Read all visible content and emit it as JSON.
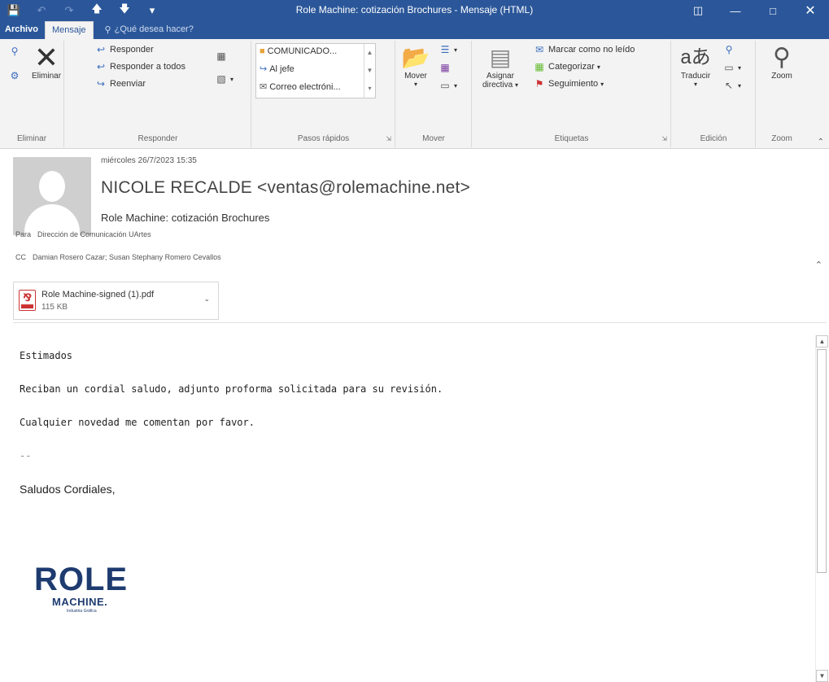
{
  "window": {
    "title": "Role Machine: cotización Brochures - Mensaje (HTML)",
    "accent": "#2b579a",
    "qat": [
      "save-icon",
      "undo-icon",
      "redo-icon",
      "arrow-up-icon",
      "arrow-down-icon",
      "customize-icon"
    ]
  },
  "tabs": {
    "file": "Archivo",
    "message": "Mensaje",
    "tell_me": "¿Qué desea hacer?"
  },
  "ribbon": {
    "delete": {
      "label": "Eliminar",
      "button": "Eliminar"
    },
    "respond": {
      "label": "Responder",
      "reply": "Responder",
      "reply_all": "Responder a todos",
      "forward": "Reenviar"
    },
    "quick_steps": {
      "label": "Pasos rápidos",
      "items": [
        "COMUNICADO...",
        "Al jefe",
        "Correo electróni..."
      ]
    },
    "move": {
      "label": "Mover",
      "button": "Mover"
    },
    "tags": {
      "label": "Etiquetas",
      "assign_policy_1": "Asignar",
      "assign_policy_2": "directiva",
      "mark_unread": "Marcar como no leído",
      "categorize": "Categorizar",
      "follow_up": "Seguimiento"
    },
    "edit": {
      "label": "Edición",
      "translate": "Traducir"
    },
    "zoom": {
      "label": "Zoom",
      "button": "Zoom"
    }
  },
  "header": {
    "date": "miércoles 26/7/2023 15:35",
    "sender": "NICOLE RECALDE <ventas@rolemachine.net>",
    "subject": "Role Machine: cotización Brochures",
    "to_label": "Para",
    "to": "Dirección de Comunicación UArtes",
    "cc_label": "CC",
    "cc": "Damian Rosero Cazar; Susan Stephany Romero Cevallos"
  },
  "attachment": {
    "name": "Role Machine-signed (1).pdf",
    "size": "115 KB"
  },
  "body": {
    "greeting": "Estimados",
    "line1": "Reciban un cordial saludo, adjunto proforma solicitada para su revisión.",
    "line2": "Cualquier novedad me comentan por favor.",
    "sig_sep": "--",
    "closing": "Saludos Cordiales,"
  },
  "logo": {
    "text": "ROLE",
    "sub": "MACHINE.",
    "tagline": "Industria Gráfica",
    "primary": "#1e3b6f",
    "accent": "#5ec4e3"
  }
}
